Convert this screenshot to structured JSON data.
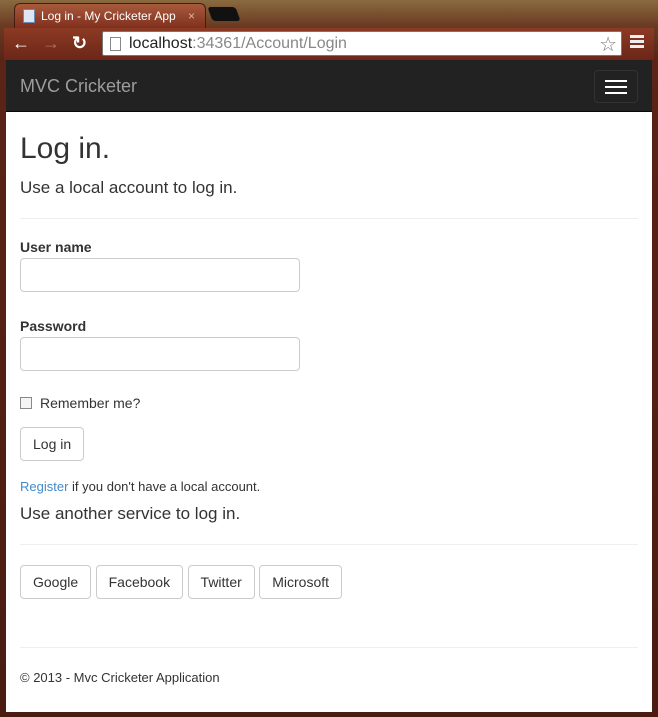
{
  "browser": {
    "tab_title": "Log in - My Cricketer App",
    "tab_close": "×",
    "url_host": "localhost",
    "url_path": ":34361/Account/Login",
    "back": "←",
    "forward": "→",
    "reload": "↻",
    "star": "☆"
  },
  "navbar": {
    "brand": "MVC Cricketer"
  },
  "page": {
    "title": "Log in.",
    "subtitle": "Use a local account to log in.",
    "username_label": "User name",
    "password_label": "Password",
    "remember_label": "Remember me?",
    "login_button": "Log in",
    "register_link": "Register",
    "register_text": " if you don't have a local account.",
    "external_title": "Use another service to log in.",
    "providers": [
      "Google",
      "Facebook",
      "Twitter",
      "Microsoft"
    ]
  },
  "footer": {
    "text": "© 2013 - Mvc Cricketer Application"
  }
}
